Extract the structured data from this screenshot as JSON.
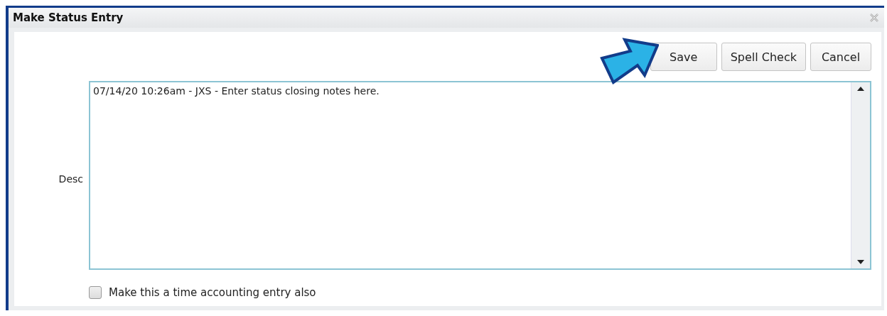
{
  "window": {
    "title": "Make Status Entry"
  },
  "buttons": [
    {
      "label": "Save",
      "highlighted": true
    },
    {
      "label": "Spell Check",
      "highlighted": false
    },
    {
      "label": "Cancel",
      "highlighted": false
    }
  ],
  "desc": {
    "label": "Desc",
    "value": "07/14/20 10:26am - JXS - Enter status closing notes here."
  },
  "time_entry": {
    "label": "Make this a time accounting entry also",
    "checked": false
  }
}
